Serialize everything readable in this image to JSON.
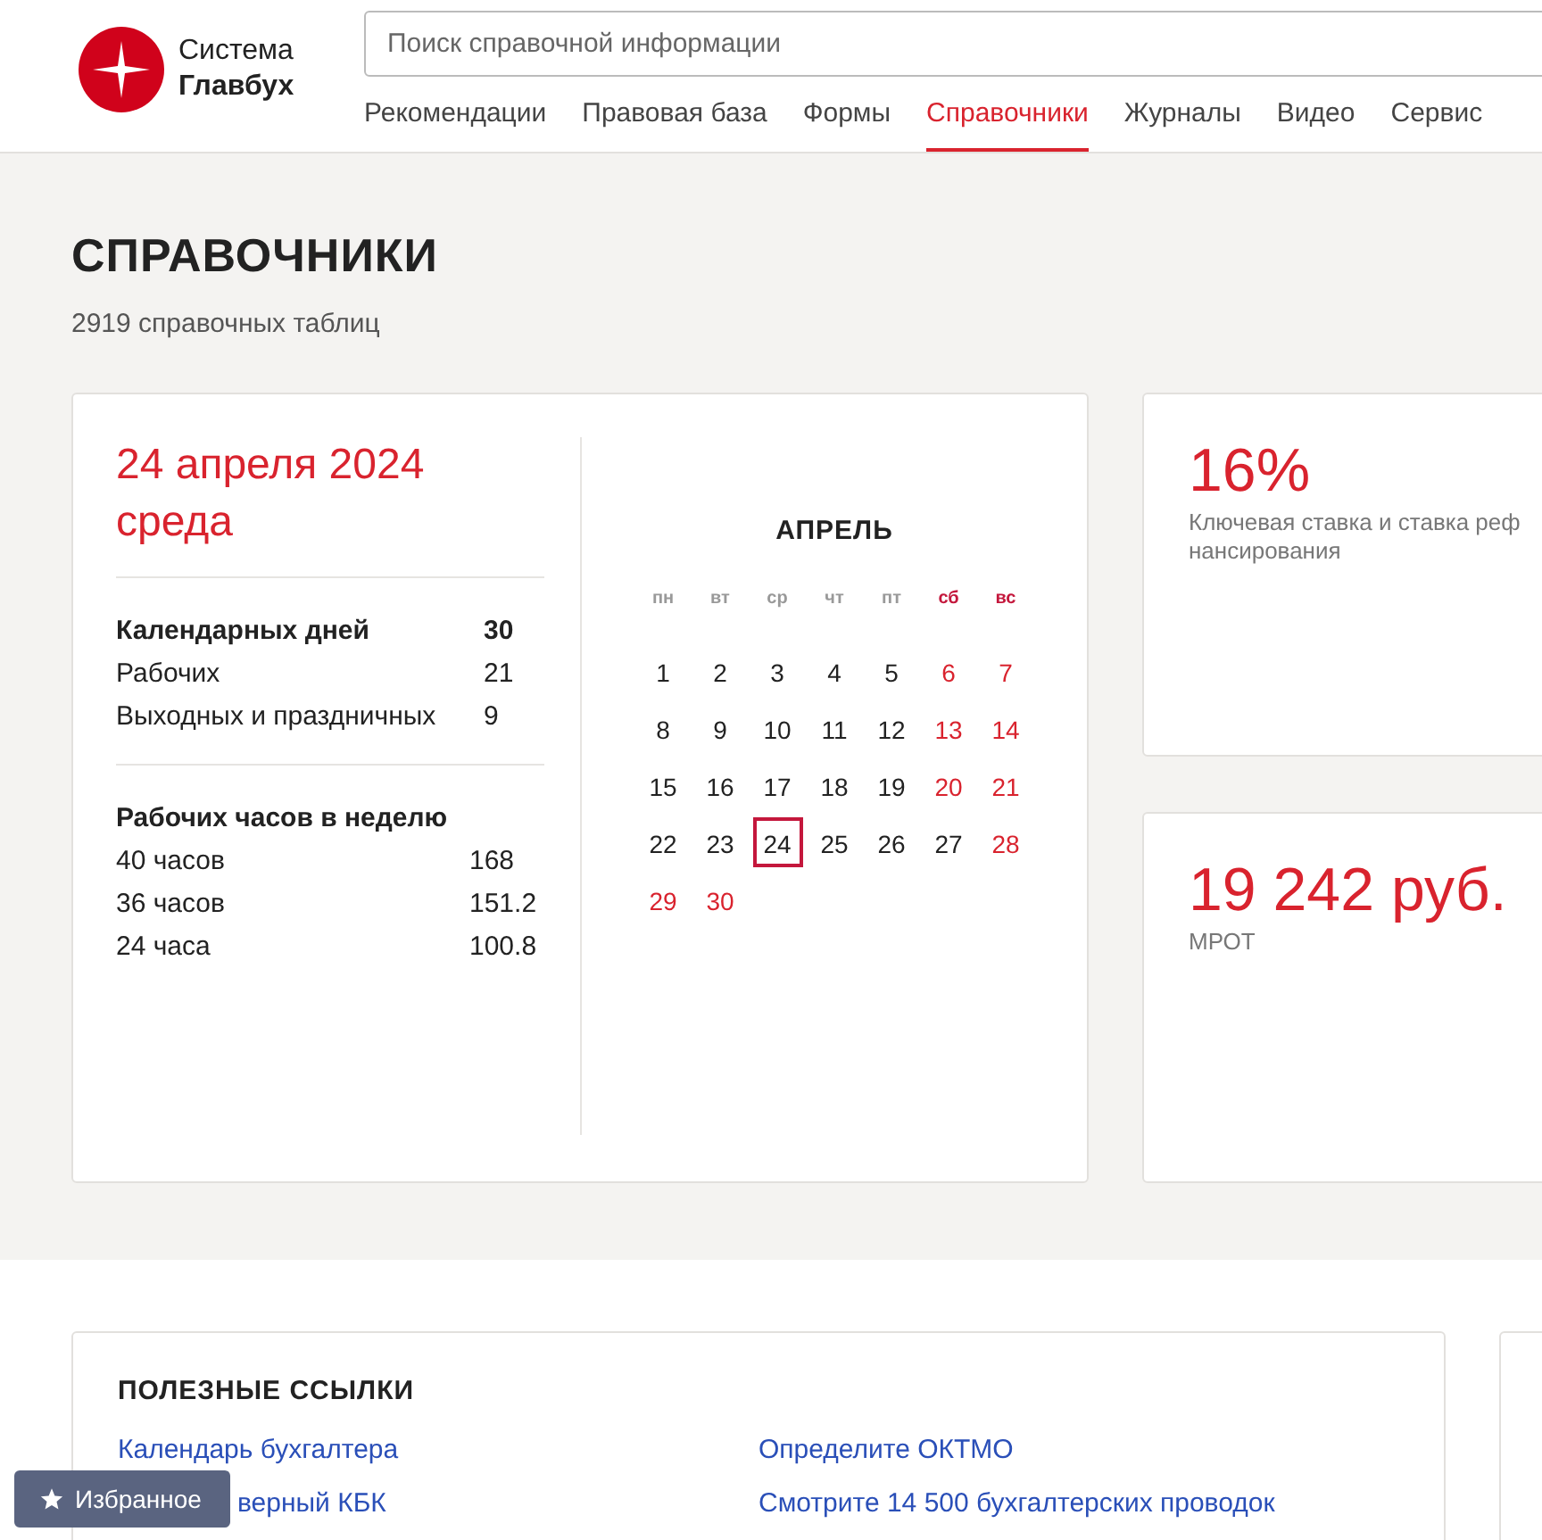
{
  "logo": {
    "line1": "Система",
    "line2": "Главбух"
  },
  "search": {
    "placeholder": "Поиск справочной информации"
  },
  "nav": [
    {
      "label": "Рекомендации",
      "selected": false
    },
    {
      "label": "Правовая база",
      "selected": false
    },
    {
      "label": "Формы",
      "selected": false
    },
    {
      "label": "Справочники",
      "selected": true
    },
    {
      "label": "Журналы",
      "selected": false
    },
    {
      "label": "Видео",
      "selected": false
    },
    {
      "label": "Сервис",
      "selected": false
    }
  ],
  "page": {
    "title": "СПРАВОЧНИКИ",
    "subtitle": "2919 справочных таблиц"
  },
  "today": {
    "date": "24 апреля 2024",
    "weekday": "среда"
  },
  "days_stats": [
    {
      "label": "Календарных дней",
      "value": "30",
      "bold": true
    },
    {
      "label": "Рабочих",
      "value": "21",
      "bold": false
    },
    {
      "label": "Выходных и праздничных",
      "value": "9",
      "bold": false
    }
  ],
  "hours": {
    "title": "Рабочих часов в неделю",
    "rows": [
      {
        "label": "40 часов",
        "value": "168"
      },
      {
        "label": "36 часов",
        "value": "151.2"
      },
      {
        "label": "24 часа",
        "value": "100.8"
      }
    ]
  },
  "calendar": {
    "month": "АПРЕЛЬ",
    "weekdays": [
      {
        "label": "пн",
        "weekend": false
      },
      {
        "label": "вт",
        "weekend": false
      },
      {
        "label": "ср",
        "weekend": false
      },
      {
        "label": "чт",
        "weekend": false
      },
      {
        "label": "пт",
        "weekend": false
      },
      {
        "label": "сб",
        "weekend": true
      },
      {
        "label": "вс",
        "weekend": true
      }
    ],
    "weeks": [
      [
        {
          "day": "1",
          "weekend": false,
          "selected": false
        },
        {
          "day": "2",
          "weekend": false,
          "selected": false
        },
        {
          "day": "3",
          "weekend": false,
          "selected": false
        },
        {
          "day": "4",
          "weekend": false,
          "selected": false
        },
        {
          "day": "5",
          "weekend": false,
          "selected": false
        },
        {
          "day": "6",
          "weekend": true,
          "selected": false
        },
        {
          "day": "7",
          "weekend": true,
          "selected": false
        }
      ],
      [
        {
          "day": "8",
          "weekend": false,
          "selected": false
        },
        {
          "day": "9",
          "weekend": false,
          "selected": false
        },
        {
          "day": "10",
          "weekend": false,
          "selected": false
        },
        {
          "day": "11",
          "weekend": false,
          "selected": false
        },
        {
          "day": "12",
          "weekend": false,
          "selected": false
        },
        {
          "day": "13",
          "weekend": true,
          "selected": false
        },
        {
          "day": "14",
          "weekend": true,
          "selected": false
        }
      ],
      [
        {
          "day": "15",
          "weekend": false,
          "selected": false
        },
        {
          "day": "16",
          "weekend": false,
          "selected": false
        },
        {
          "day": "17",
          "weekend": false,
          "selected": false
        },
        {
          "day": "18",
          "weekend": false,
          "selected": false
        },
        {
          "day": "19",
          "weekend": false,
          "selected": false
        },
        {
          "day": "20",
          "weekend": true,
          "selected": false
        },
        {
          "day": "21",
          "weekend": true,
          "selected": false
        }
      ],
      [
        {
          "day": "22",
          "weekend": false,
          "selected": false
        },
        {
          "day": "23",
          "weekend": false,
          "selected": false
        },
        {
          "day": "24",
          "weekend": false,
          "selected": true
        },
        {
          "day": "25",
          "weekend": false,
          "selected": false
        },
        {
          "day": "26",
          "weekend": false,
          "selected": false
        },
        {
          "day": "27",
          "weekend": false,
          "selected": false
        },
        {
          "day": "28",
          "weekend": true,
          "selected": false
        }
      ],
      [
        {
          "day": "29",
          "weekend": true,
          "selected": false
        },
        {
          "day": "30",
          "weekend": true,
          "selected": false
        }
      ]
    ]
  },
  "indicators": [
    {
      "value": "16%",
      "lines": [
        "Ключевая ставка и ставка реф",
        "нансирования"
      ]
    },
    {
      "value": "19 242 руб.",
      "lines": [
        "МРОТ"
      ]
    }
  ],
  "links": {
    "title": "ПОЛЕЗНЫЕ ССЫЛКИ",
    "left": [
      "Календарь бухгалтера",
      "верный КБК"
    ],
    "right": [
      "Определите ОКТМО",
      "Смотрите 14 500 бухгалтерских проводок"
    ]
  },
  "favorites": {
    "label": "Избранное"
  }
}
